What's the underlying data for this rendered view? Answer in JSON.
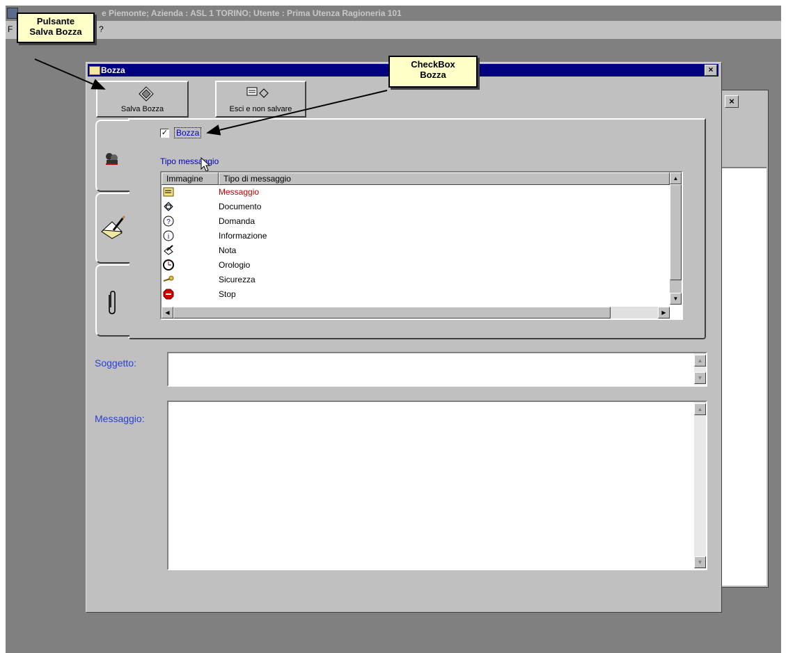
{
  "app": {
    "title": "e Piemonte; Azienda : ASL 1 TORINO; Utente : Prima Utenza Ragioneria 101",
    "menu": [
      "F",
      "?"
    ]
  },
  "dialog": {
    "title": "Bozza",
    "close_symbol": "×",
    "toolbar": {
      "save_label": "Salva Bozza",
      "exit_label": "Esci e non salvare"
    },
    "tabs": [
      {
        "icon": "recipients-icon"
      },
      {
        "icon": "message-edit-icon",
        "active": true
      },
      {
        "icon": "paperclip-icon"
      }
    ],
    "draft_checkbox": {
      "label": "Bozza",
      "checked": true,
      "check_mark": "✓"
    },
    "message_type_label": "Tipo messaggio",
    "list": {
      "columns": [
        "Immagine",
        "Tipo di messaggio"
      ],
      "rows": [
        {
          "icon": "message-icon",
          "label": "Messaggio",
          "color": "#c00000"
        },
        {
          "icon": "document-icon",
          "label": "Documento",
          "color": "#000000"
        },
        {
          "icon": "question-icon",
          "label": "Domanda",
          "color": "#000000"
        },
        {
          "icon": "info-icon",
          "label": "Informazione",
          "color": "#000000"
        },
        {
          "icon": "note-icon",
          "label": "Nota",
          "color": "#000000"
        },
        {
          "icon": "clock-icon",
          "label": "Orologio",
          "color": "#000000"
        },
        {
          "icon": "key-icon",
          "label": "Sicurezza",
          "color": "#000000"
        },
        {
          "icon": "stop-icon",
          "label": "Stop",
          "color": "#000000"
        }
      ]
    },
    "subject_label": "Soggetto:",
    "subject_value": "",
    "message_label": "Messaggio:",
    "message_value": ""
  },
  "annotations": {
    "save_callout": [
      "Pulsante",
      "Salva Bozza"
    ],
    "checkbox_callout": [
      "CheckBox",
      "Bozza"
    ]
  },
  "colors": {
    "titlebar_active": "#000080",
    "label_blue": "#2a3fd0",
    "callout_bg": "#ffffc8"
  }
}
